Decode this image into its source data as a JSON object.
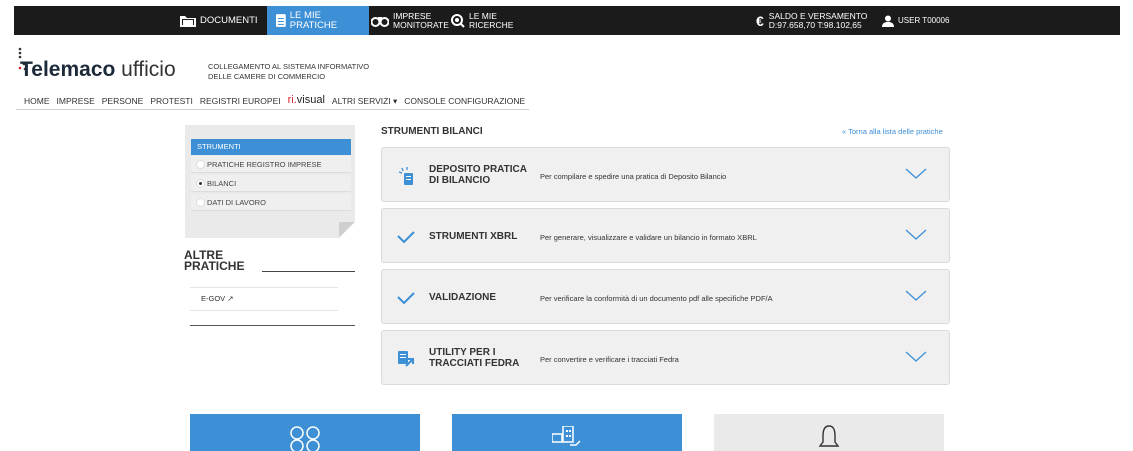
{
  "topbar": {
    "documenti": "DOCUMENTI",
    "le_mie_pratiche": "LE MIE PRATICHE",
    "imprese_line1": "IMPRESE",
    "imprese_line2": "MONITORATE",
    "ricerche_line1": "LE MIE",
    "ricerche_line2": "RICERCHE",
    "saldo_line1": "SALDO E VERSAMENTO",
    "saldo_line2": "D:97.658,70 T:98.102,65",
    "user": "USER T00006"
  },
  "brand": {
    "name_prefix": "Telemaco",
    "name_suffix": "ufficio",
    "subtitle_line1": "COLLEGAMENTO AL SISTEMA INFORMATIVO",
    "subtitle_line2": "DELLE CAMERE DI COMMERCIO"
  },
  "nav": {
    "items": [
      "HOME",
      "IMPRESE",
      "PERSONE",
      "PROTESTI",
      "REGISTRI EUROPEI"
    ],
    "rivisual_ri": "ri.",
    "rivisual_rest": "visual",
    "altri_servizi": "ALTRI SERVIZI ▾",
    "console": "CONSOLE CONFIGURAZIONE"
  },
  "sidebar": {
    "header": "STRUMENTI",
    "items": [
      {
        "label": "PRATICHE REGISTRO IMPRESE",
        "selected": false
      },
      {
        "label": "BILANCI",
        "selected": true
      },
      {
        "label": "DATI DI LAVORO",
        "selected": false
      }
    ],
    "altre_line1": "ALTRE",
    "altre_line2": "PRATICHE",
    "egov": "E-GOV ↗"
  },
  "main": {
    "title": "STRUMENTI BILANCI",
    "back_link": "« Torna alla lista delle pratiche",
    "cards": [
      {
        "title_line1": "DEPOSITO PRATICA",
        "title_line2": "DI BILANCIO",
        "desc": "Per compilare e spedire una pratica di Deposito Bilancio",
        "icon": "document-icon"
      },
      {
        "title_line1": "STRUMENTI XBRL",
        "title_line2": "",
        "desc": "Per generare, visualizzare e validare un bilancio in formato XBRL",
        "icon": "check-icon"
      },
      {
        "title_line1": "VALIDAZIONE",
        "title_line2": "",
        "desc": "Per verificare la conformità di un documento pdf alle specifiche PDF/A",
        "icon": "check-icon"
      },
      {
        "title_line1": "UTILITY PER I",
        "title_line2": "TRACCIATI FEDRA",
        "desc": "Per convertire e verificare i tracciati Fedra",
        "icon": "convert-icon"
      }
    ]
  },
  "colors": {
    "accent": "#3d8fd6",
    "topbar": "#1b1b1b",
    "brand_red": "#d8242b"
  }
}
